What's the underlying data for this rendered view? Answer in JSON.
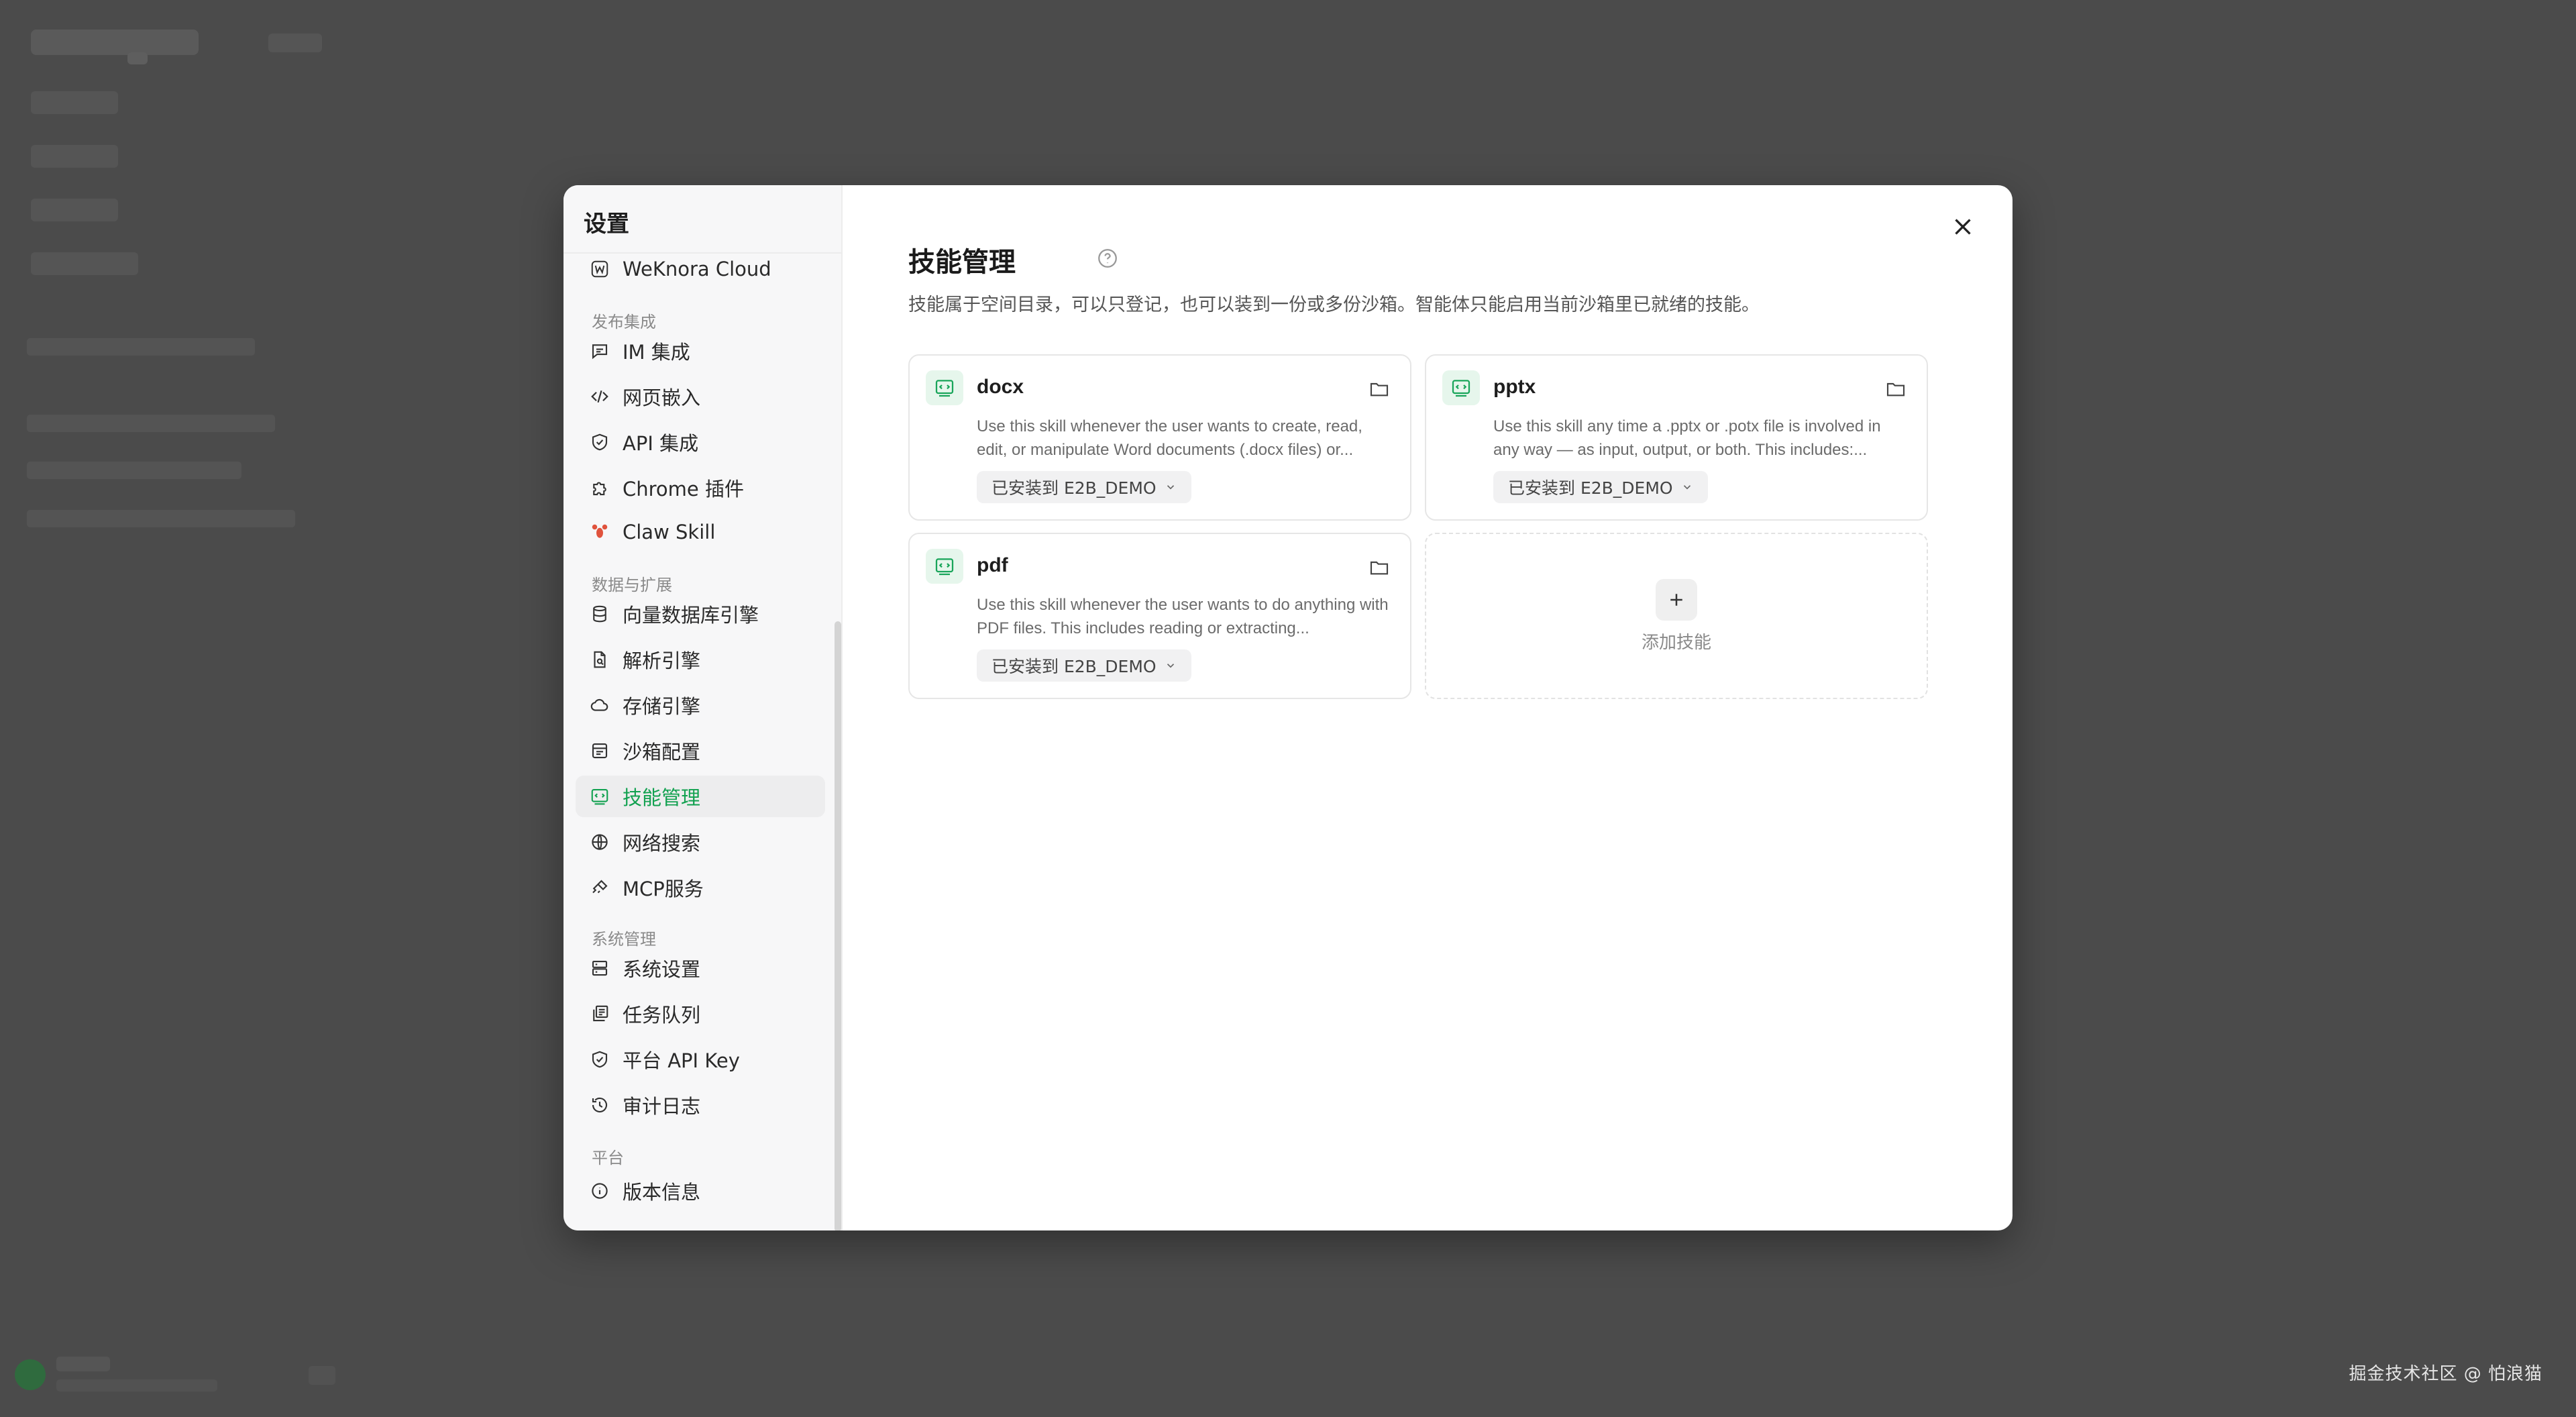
{
  "watermark": "掘金技术社区 @ 怕浪猫",
  "modal": {
    "title": "设置",
    "nav": {
      "top_item": "WeKnora Cloud",
      "sections": [
        {
          "title": "发布集成",
          "items": [
            "IM 集成",
            "网页嵌入",
            "API 集成",
            "Chrome 插件",
            "Claw Skill"
          ]
        },
        {
          "title": "数据与扩展",
          "items": [
            "向量数据库引擎",
            "解析引擎",
            "存储引擎",
            "沙箱配置",
            "技能管理",
            "网络搜索",
            "MCP服务"
          ]
        },
        {
          "title": "系统管理",
          "items": [
            "系统设置",
            "任务队列",
            "平台 API Key",
            "审计日志"
          ]
        },
        {
          "title": "平台",
          "items": [
            "版本信息"
          ]
        }
      ],
      "active": "技能管理"
    },
    "main": {
      "title": "技能管理",
      "description": "技能属于空间目录，可以只登记，也可以装到一份或多份沙箱。智能体只能启用当前沙箱里已就绪的技能。",
      "skills": [
        {
          "name": "docx",
          "description": "Use this skill whenever the user wants to create, read, edit, or manipulate Word documents (.docx files) or...",
          "status": "已安装到 E2B_DEMO"
        },
        {
          "name": "pptx",
          "description": "Use this skill any time a .pptx or .potx file is involved in any way — as input, output, or both. This includes:...",
          "status": "已安装到 E2B_DEMO"
        },
        {
          "name": "pdf",
          "description": "Use this skill whenever the user wants to do anything with PDF files. This includes reading or extracting...",
          "status": "已安装到 E2B_DEMO"
        }
      ],
      "add_skill_label": "添加技能"
    }
  },
  "colors": {
    "accent": "#12a150",
    "overlay": "#4b4b4b",
    "card_icon_bg": "#e6f6ec"
  }
}
